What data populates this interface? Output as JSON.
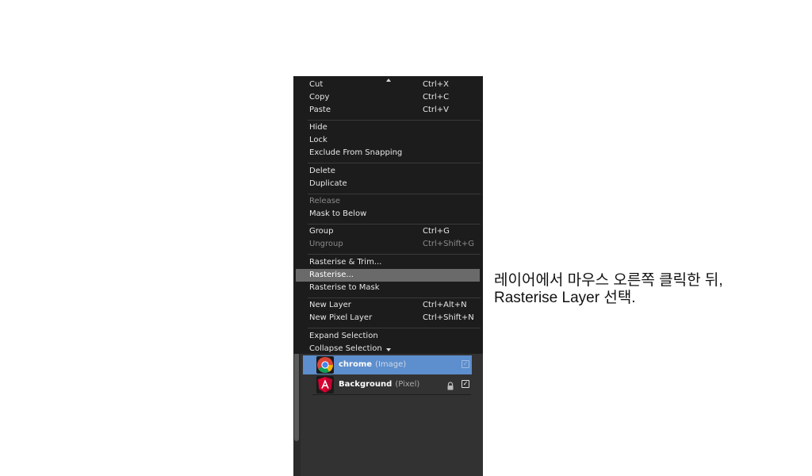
{
  "context_menu": {
    "partial_top": {
      "label": "Cut",
      "shortcut": "Ctrl+X"
    },
    "items": [
      {
        "label": "Copy",
        "shortcut": "Ctrl+C"
      },
      {
        "label": "Paste",
        "shortcut": "Ctrl+V"
      },
      {
        "label": "Hide",
        "shortcut": ""
      },
      {
        "label": "Lock",
        "shortcut": ""
      },
      {
        "label": "Exclude From Snapping",
        "shortcut": ""
      },
      {
        "label": "Delete",
        "shortcut": ""
      },
      {
        "label": "Duplicate",
        "shortcut": ""
      },
      {
        "label": "Release",
        "shortcut": "",
        "disabled": true
      },
      {
        "label": "Mask to Below",
        "shortcut": ""
      },
      {
        "label": "Group",
        "shortcut": "Ctrl+G"
      },
      {
        "label": "Ungroup",
        "shortcut": "Ctrl+Shift+G",
        "disabled": true
      },
      {
        "label": "Rasterise & Trim...",
        "shortcut": ""
      },
      {
        "label": "Rasterise...",
        "shortcut": "",
        "highlighted": true
      },
      {
        "label": "Rasterise to Mask",
        "shortcut": ""
      },
      {
        "label": "New Layer",
        "shortcut": "Ctrl+Alt+N"
      },
      {
        "label": "New Pixel Layer",
        "shortcut": "Ctrl+Shift+N"
      },
      {
        "label": "Expand Selection",
        "shortcut": ""
      }
    ],
    "partial_bottom": {
      "label": "Collapse Selection",
      "shortcut": ""
    }
  },
  "layers": [
    {
      "name": "chrome",
      "type": "(Image)",
      "selected": true,
      "locked": false,
      "visible": true,
      "icon": "chrome-icon"
    },
    {
      "name": "Background",
      "type": "(Pixel)",
      "selected": false,
      "locked": true,
      "visible": true,
      "icon": "angular-icon"
    }
  ],
  "instruction": {
    "line1": "레이어에서 마우스 오른쪽 클릭한 뒤,",
    "line2": "Rasterise Layer 선택."
  },
  "colors": {
    "menu_bg": "#1c1c1c",
    "panel_bg": "#323232",
    "selection_blue": "#5d8ecd",
    "hover_gray": "#6a6a6a"
  }
}
